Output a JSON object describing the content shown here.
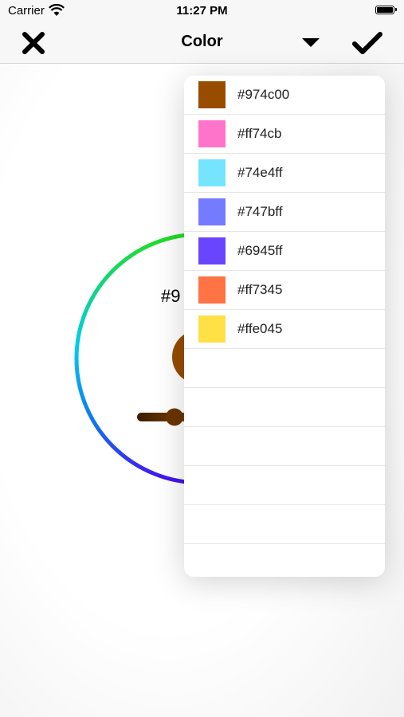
{
  "status_bar": {
    "carrier": "Carrier",
    "time": "11:27 PM"
  },
  "nav": {
    "title": "Color",
    "close_icon": "close-x-icon",
    "dropdown_icon": "triangle-down-icon",
    "done_icon": "checkmark-icon"
  },
  "picker": {
    "hex_partial": "#9",
    "selected_color": "#974c00",
    "slider_value": 0.35
  },
  "palette": [
    {
      "hex": "#974c00",
      "color": "#974c00"
    },
    {
      "hex": "#ff74cb",
      "color": "#ff74cb"
    },
    {
      "hex": "#74e4ff",
      "color": "#74e4ff"
    },
    {
      "hex": "#747bff",
      "color": "#747bff"
    },
    {
      "hex": "#6945ff",
      "color": "#6945ff"
    },
    {
      "hex": "#ff7345",
      "color": "#ff7345"
    },
    {
      "hex": "#ffe045",
      "color": "#ffe045"
    }
  ],
  "empty_rows": 6
}
